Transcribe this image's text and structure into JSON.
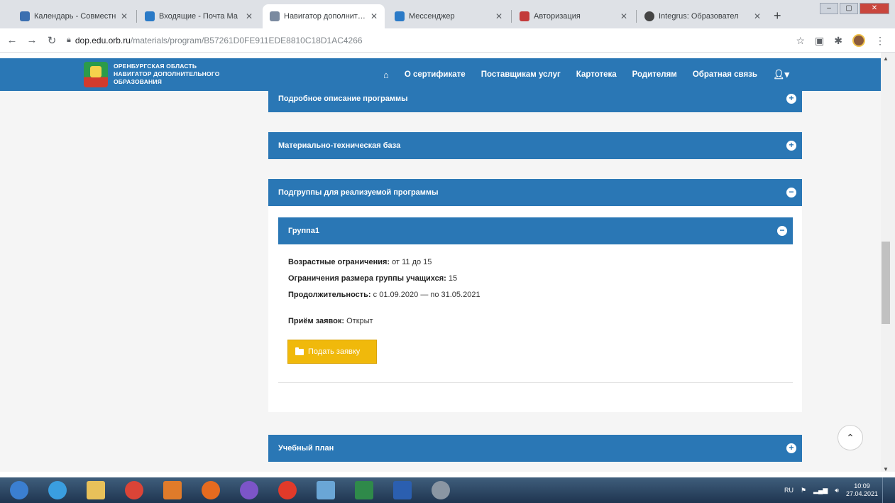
{
  "browser": {
    "tabs": [
      {
        "title": "Календарь - Совместн",
        "color": "#3b6fb0",
        "active": false
      },
      {
        "title": "Входящие - Почта Ма",
        "color": "#2a7ac7",
        "active": false
      },
      {
        "title": "Навигатор дополнител",
        "color": "#7a8aa0",
        "active": true
      },
      {
        "title": "Мессенджер",
        "color": "#2a7ac7",
        "active": false
      },
      {
        "title": "Авторизация",
        "color": "#c33a3a",
        "active": false
      },
      {
        "title": "Integrus: Образовател",
        "color": "#444444",
        "active": false
      }
    ],
    "url_host": "dop.edu.orb.ru",
    "url_path": "/materials/program/B57261D0FE911EDE8810C18D1AC4266"
  },
  "header": {
    "brand_line1": "ОРЕНБУРГСКАЯ ОБЛАСТЬ",
    "brand_line2": "НАВИГАТОР ДОПОЛНИТЕЛЬНОГО",
    "brand_line3": "ОБРАЗОВАНИЯ",
    "menu": [
      "О сертификате",
      "Поставщикам услуг",
      "Картотека",
      "Родителям",
      "Обратная связь"
    ]
  },
  "content": {
    "panel_description": "Подробное описание программы",
    "panel_material": "Материально-техническая база",
    "panel_subgroups": "Подгруппы для реализуемой программы",
    "group_title": "Группа1",
    "age_label": "Возрастные ограничения:",
    "age_value": "от 11 до 15",
    "size_label": "Ограничения размера группы учащихся:",
    "size_value": "15",
    "duration_label": "Продолжительность:",
    "duration_value": "с 01.09.2020 — по 31.05.2021",
    "intake_label": "Приём заявок:",
    "intake_value": "Открыт",
    "apply_button": "Подать заявку",
    "panel_plan": "Учебный план"
  },
  "taskbar": {
    "lang": "RU",
    "time": "10:09",
    "date": "27.04.2021",
    "icons": [
      {
        "name": "start-icon",
        "color": "#3b7fd1"
      },
      {
        "name": "ie-icon",
        "color": "#3a9ee0"
      },
      {
        "name": "explorer-icon",
        "color": "#e8c15a"
      },
      {
        "name": "chrome-icon",
        "color": "#db4437"
      },
      {
        "name": "media-icon",
        "color": "#e07b2a"
      },
      {
        "name": "firefox-icon",
        "color": "#e66b1f"
      },
      {
        "name": "viber-icon",
        "color": "#7c55c8"
      },
      {
        "name": "yandex-icon",
        "color": "#e23a2a"
      },
      {
        "name": "photo-icon",
        "color": "#6aa6d6"
      },
      {
        "name": "excel-icon",
        "color": "#2f8a4a"
      },
      {
        "name": "word-icon",
        "color": "#2b5fb0"
      },
      {
        "name": "misc-icon",
        "color": "#8a96a3"
      }
    ]
  }
}
